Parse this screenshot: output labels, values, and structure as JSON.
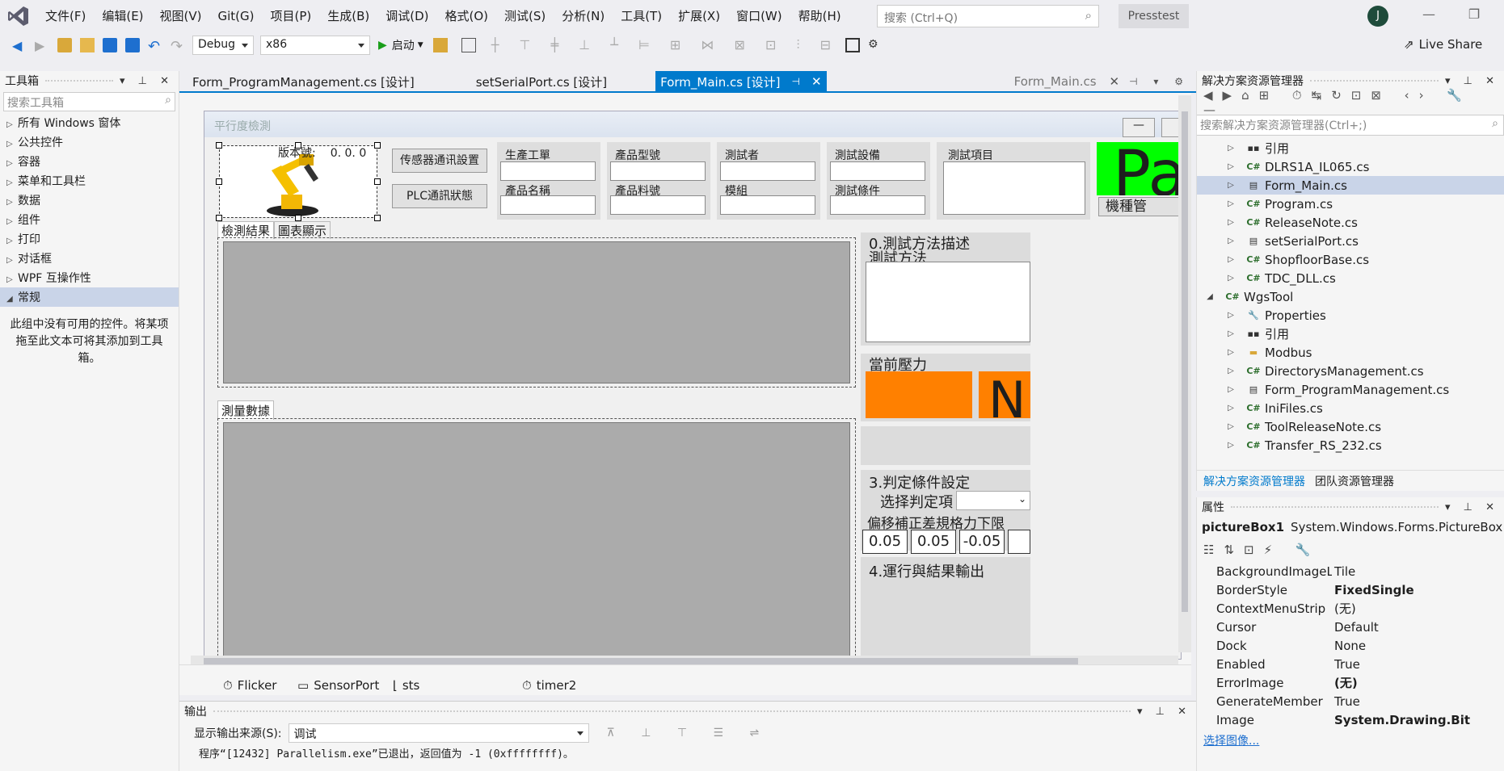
{
  "menu": {
    "items": [
      "文件(F)",
      "编辑(E)",
      "视图(V)",
      "Git(G)",
      "项目(P)",
      "生成(B)",
      "调试(D)",
      "格式(O)",
      "测试(S)",
      "分析(N)",
      "工具(T)",
      "扩展(X)",
      "窗口(W)",
      "帮助(H)"
    ],
    "search_placeholder": "搜索 (Ctrl+Q)",
    "solution_name": "Presstest",
    "avatar_letter": "J"
  },
  "toolbar": {
    "config": "Debug",
    "platform": "x86",
    "start_label": "启动",
    "live_share": "Live Share"
  },
  "toolbox": {
    "title": "工具箱",
    "search_placeholder": "搜索工具箱",
    "categories": [
      "所有 Windows 窗体",
      "公共控件",
      "容器",
      "菜单和工具栏",
      "数据",
      "组件",
      "打印",
      "对话框",
      "WPF 互操作性",
      "常规"
    ],
    "selected": "常规",
    "empty_message": "此组中没有可用的控件。将某项拖至此文本可将其添加到工具箱。"
  },
  "doc_tabs": {
    "tabs": [
      "Form_ProgramManagement.cs [设计]",
      "setSerialPort.cs [设计]",
      "Form_Main.cs [设计]"
    ],
    "active": "Form_Main.cs [设计]",
    "preview": "Form_Main.cs"
  },
  "form": {
    "title": "平行度檢測",
    "version_label": "版本號:",
    "version_value": "0. 0. 0",
    "sensor_button": "传感器通讯設置",
    "plc_button": "PLC通訊狀態",
    "fields": {
      "work_order": "生產工單",
      "product_name": "產品名稱",
      "product_model": "產品型號",
      "part_number": "產品料號",
      "tester": "測試者",
      "module": "模組",
      "test_equipment": "測試設備",
      "test_condition": "測試條件",
      "test_item": "測試項目"
    },
    "big_label_partial": "Pa",
    "model_mgmt_partial": "機種管",
    "tab_result": "檢測結果",
    "tab_chart": "圖表顯示",
    "measure_tab": "測量數據",
    "section0_title": "0.測試方法描述",
    "section0_sub": "測試方法",
    "pressure_label": "當前壓力",
    "ng_partial": "N",
    "section3_title": "3.判定條件設定",
    "select_label": "选择判定項",
    "cond_labels": [
      "偏移補正",
      "差規格",
      "力下限"
    ],
    "cond_values": [
      "0.05",
      "0.05",
      "-0.05"
    ],
    "section4_title": "4.運行與結果輸出"
  },
  "tray": {
    "items": [
      "Flicker",
      "SensorPort",
      "sts",
      "timer2"
    ]
  },
  "output": {
    "title": "输出",
    "source_label": "显示输出来源(S):",
    "source_value": "调试",
    "line": "程序“[12432] Parallelism.exe”已退出，返回值为 -1 (0xffffffff)。"
  },
  "solution_explorer": {
    "title": "解决方案资源管理器",
    "search_placeholder": "搜索解决方案资源管理器(Ctrl+;)",
    "items": [
      {
        "label": "引用",
        "icon": "references-icon",
        "depth": 1
      },
      {
        "label": "DLRS1A_IL065.cs",
        "icon": "csharp-icon",
        "depth": 1
      },
      {
        "label": "Form_Main.cs",
        "icon": "form-icon",
        "depth": 1
      },
      {
        "label": "Program.cs",
        "icon": "csharp-icon",
        "depth": 1
      },
      {
        "label": "ReleaseNote.cs",
        "icon": "csharp-icon",
        "depth": 1
      },
      {
        "label": "setSerialPort.cs",
        "icon": "form-icon",
        "depth": 1
      },
      {
        "label": "ShopfloorBase.cs",
        "icon": "csharp-icon",
        "depth": 1
      },
      {
        "label": "TDC_DLL.cs",
        "icon": "csharp-icon",
        "depth": 1
      },
      {
        "label": "WgsTool",
        "icon": "project-icon",
        "depth": 0
      },
      {
        "label": "Properties",
        "icon": "wrench-icon",
        "depth": 1
      },
      {
        "label": "引用",
        "icon": "references-icon",
        "depth": 1
      },
      {
        "label": "Modbus",
        "icon": "folder-icon",
        "depth": 1
      },
      {
        "label": "DirectorysManagement.cs",
        "icon": "csharp-icon",
        "depth": 1
      },
      {
        "label": "Form_ProgramManagement.cs",
        "icon": "form-icon",
        "depth": 1
      },
      {
        "label": "IniFiles.cs",
        "icon": "csharp-icon",
        "depth": 1
      },
      {
        "label": "ToolReleaseNote.cs",
        "icon": "csharp-icon",
        "depth": 1
      },
      {
        "label": "Transfer_RS_232.cs",
        "icon": "csharp-icon",
        "depth": 1
      }
    ],
    "selected": "Form_Main.cs",
    "tab_solution": "解决方案资源管理器",
    "tab_team": "团队资源管理器"
  },
  "properties": {
    "title": "属性",
    "object_name": "pictureBox1",
    "object_type": "System.Windows.Forms.PictureBox",
    "rows": [
      {
        "name": "BackgroundImageLayc",
        "value": "Tile",
        "bold": false
      },
      {
        "name": "BorderStyle",
        "value": "FixedSingle",
        "bold": true
      },
      {
        "name": "ContextMenuStrip",
        "value": "(无)",
        "bold": false
      },
      {
        "name": "Cursor",
        "value": "Default",
        "bold": false
      },
      {
        "name": "Dock",
        "value": "None",
        "bold": false
      },
      {
        "name": "Enabled",
        "value": "True",
        "bold": false
      },
      {
        "name": "ErrorImage",
        "value": "(无)",
        "bold": true
      },
      {
        "name": "GenerateMember",
        "value": "True",
        "bold": false
      },
      {
        "name": "Image",
        "value": "System.Drawing.Bit",
        "bold": true
      }
    ],
    "link": "选择图像..."
  },
  "colors": {
    "accent": "#007acc",
    "green_panel": "#00ff00",
    "orange_panel": "#ff8000",
    "selection": "#c9d4e8"
  }
}
